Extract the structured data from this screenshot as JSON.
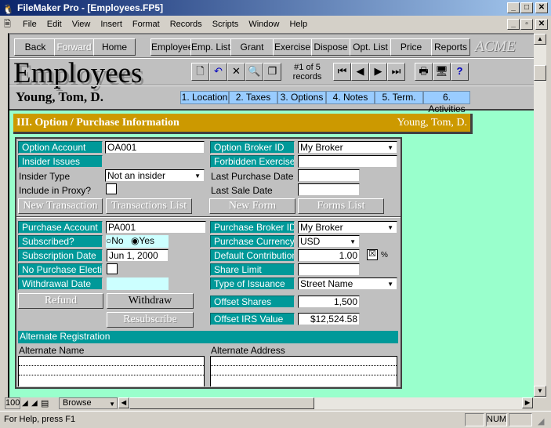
{
  "window": {
    "title": "FileMaker Pro - [Employees.FP5]"
  },
  "menu": [
    "File",
    "Edit",
    "View",
    "Insert",
    "Format",
    "Records",
    "Scripts",
    "Window",
    "Help"
  ],
  "nav": {
    "back": "Back",
    "forward": "Forward",
    "home": "Home",
    "modules": [
      "Employee",
      "Emp. List",
      "Grant",
      "Exercise",
      "Dispose",
      "Opt. List",
      "Price",
      "Reports"
    ],
    "logo": "ACME"
  },
  "header": {
    "title": "Employees",
    "record_pos": "#1 of 5",
    "record_unit": "records",
    "employee": "Young, Tom, D."
  },
  "tabs": [
    "1. Location",
    "2. Taxes",
    "3. Options",
    "4. Notes",
    "5. Term.",
    "6. Activities"
  ],
  "section": {
    "title": "III. Option / Purchase Information",
    "employee": "Young, Tom, D."
  },
  "option": {
    "account_label": "Option Account",
    "account": "OA001",
    "broker_label": "Option Broker ID",
    "broker": "My Broker",
    "insider_issues_label": "Insider Issues",
    "forbidden_label": "Forbidden Exercises",
    "forbidden": "",
    "insider_type_label": "Insider Type",
    "insider_type": "Not an insider",
    "last_purchase_label": "Last Purchase Date",
    "last_purchase": "",
    "proxy_label": "Include in Proxy?",
    "proxy_checked": false,
    "last_sale_label": "Last Sale Date",
    "last_sale": "",
    "new_transaction": "New Transaction",
    "transactions_list": "Transactions List",
    "new_form": "New Form",
    "forms_list": "Forms List"
  },
  "purchase": {
    "account_label": "Purchase Account",
    "account": "PA001",
    "broker_label": "Purchase Broker ID",
    "broker": "My Broker",
    "subscribed_label": "Subscribed?",
    "no": "No",
    "yes": "Yes",
    "subscribed": "Yes",
    "currency_label": "Purchase Currency",
    "currency": "USD",
    "sub_date_label": "Subscription Date",
    "sub_date": "Jun 1, 2000",
    "contribution_label": "Default Contribution",
    "contribution": "1.00",
    "percent": "%",
    "percent_checked": true,
    "no_election_label": "No Purchase Election",
    "no_election_checked": false,
    "share_limit_label": "Share Limit",
    "share_limit": "",
    "withdrawal_label": "Withdrawal Date",
    "withdrawal": "",
    "issuance_label": "Type of Issuance",
    "issuance": "Street Name",
    "refund": "Refund",
    "withdraw": "Withdraw",
    "resubscribe": "Resubscribe",
    "offset_shares_label": "Offset Shares",
    "offset_shares": "1,500",
    "offset_irs_label": "Offset IRS Value",
    "offset_irs": "$12,524.58"
  },
  "alternate": {
    "title": "Alternate Registration",
    "name_label": "Alternate Name",
    "address_label": "Alternate Address"
  },
  "bottom": {
    "zoom": "100",
    "mode": "Browse"
  },
  "status": {
    "help": "For Help, press F1",
    "num": "NUM"
  }
}
